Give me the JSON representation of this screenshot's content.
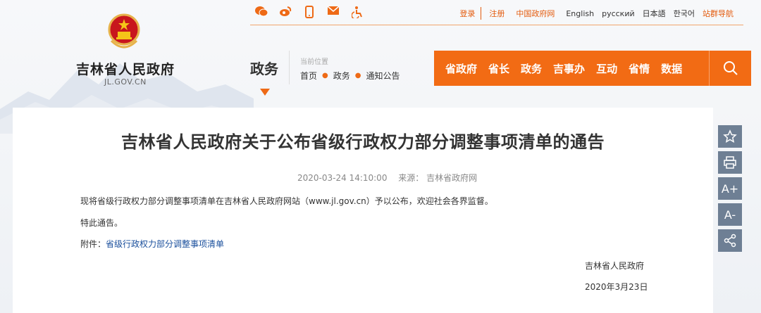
{
  "site": {
    "name": "吉林省人民政府",
    "domain": "JL.GOV.CN"
  },
  "topbar": {
    "share_icons": [
      "wechat-icon",
      "weibo-icon",
      "mobile-icon",
      "mail-icon",
      "accessibility-icon"
    ],
    "login": "登录",
    "register": "注册",
    "gov_link": "中国政府网",
    "languages": [
      "English",
      "русский",
      "日本語",
      "한국어"
    ],
    "site_nav": "站群导航"
  },
  "section": {
    "title": "政务",
    "location_label": "当前位置",
    "breadcrumb": [
      "首页",
      "政务",
      "通知公告"
    ]
  },
  "mainnav": {
    "items": [
      "省政府",
      "省长",
      "政务",
      "吉事办",
      "互动",
      "省情",
      "数据"
    ]
  },
  "article": {
    "title": "吉林省人民政府关于公布省级行政权力部分调整事项清单的通告",
    "date": "2020-03-24 14:10:00",
    "source": "来源： 吉林省政府网",
    "para1": "现将省级行政权力部分调整事项清单在吉林省人民政府网站（www.jl.gov.cn）予以公布，欢迎社会各界监督。",
    "para2": "特此通告。",
    "attachment_label": "附件：",
    "attachment_link": "省级行政权力部分调整事项清单",
    "signer": "吉林省人民政府",
    "sign_date": "2020年3月23日"
  },
  "sidetools": {
    "font_increase": "A+",
    "font_decrease": "A-"
  },
  "colors": {
    "accent": "#f26b14",
    "tool_bg": "#6e7f94"
  }
}
